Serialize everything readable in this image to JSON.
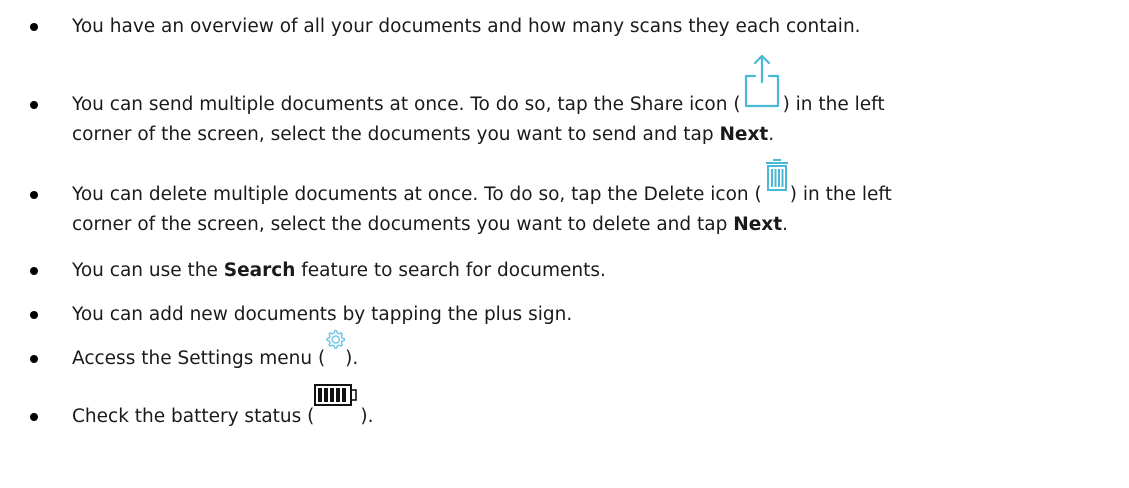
{
  "bullets": {
    "overview": {
      "text": "You have an overview of all your documents and how many scans they each contain."
    },
    "share": {
      "line1_before_icon": "You can send multiple documents at once. To do so, tap the Share icon (",
      "line1_after_icon": ") in the left",
      "line2_before_bold": "corner of the screen, select the documents you want to send and tap ",
      "bold": "Next",
      "line2_end": ".",
      "icon": "share-icon"
    },
    "delete": {
      "line1_before_icon": "You can delete multiple documents at once. To do so, tap the Delete icon (",
      "line1_after_icon": ") in the left",
      "line2_before_bold": "corner of the screen, select the documents you want to delete and tap ",
      "bold": "Next",
      "line2_end": ".",
      "icon": "trash-icon"
    },
    "search": {
      "before_bold": "You can use the ",
      "bold": "Search",
      "after_bold": " feature to search for documents."
    },
    "add": {
      "text": "You can add new documents by tapping the plus sign."
    },
    "settings": {
      "before_icon": "Access the Settings menu (",
      "after_icon": ").",
      "icon": "gear-icon"
    },
    "battery": {
      "before_icon": "Check the battery status (",
      "after_icon": ").",
      "icon": "battery-icon"
    }
  },
  "colors": {
    "icon_accent": "#4bb8d8",
    "text": "#1a1a1a"
  }
}
